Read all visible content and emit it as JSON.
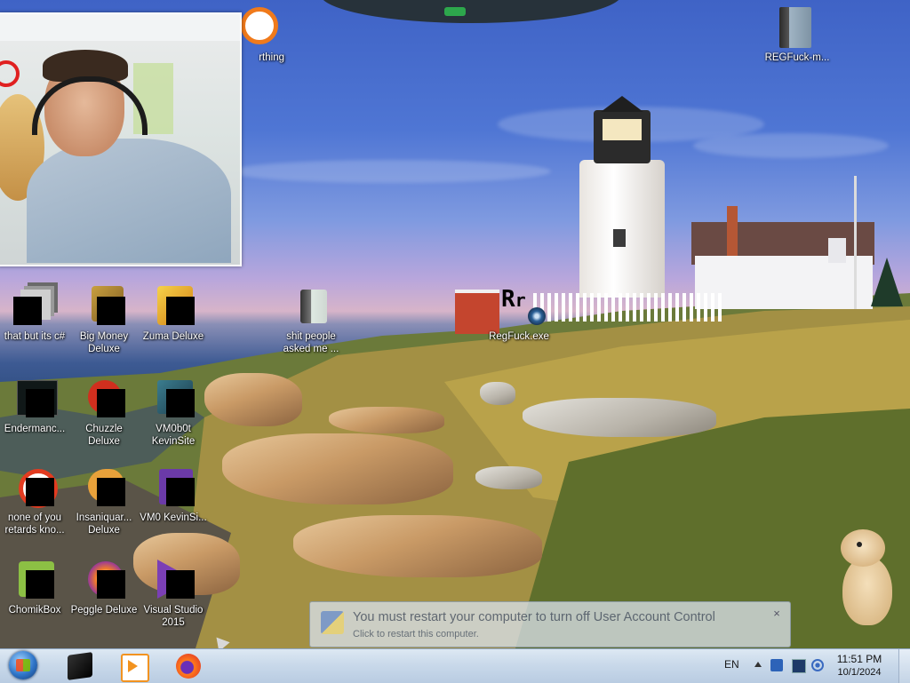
{
  "desktop": {
    "icons": [
      {
        "label": "that but its c#",
        "icon": "folder-stack-icon"
      },
      {
        "label": "Big Money Deluxe",
        "icon": "money-bag-icon"
      },
      {
        "label": "Zuma Deluxe",
        "icon": "zuma-icon"
      },
      {
        "label": "shit people asked me ...",
        "icon": "folder-icon"
      },
      {
        "label": "RegFuck.exe",
        "icon": "regfuck-exe-icon"
      },
      {
        "label": "REGFuck-m...",
        "icon": "folder-icon"
      },
      {
        "label": "Endermanc...",
        "icon": "enderman-icon"
      },
      {
        "label": "Chuzzle Deluxe",
        "icon": "chuzzle-icon"
      },
      {
        "label": "VM0b0t KevinSite",
        "icon": "vmobot-icon"
      },
      {
        "label": "none of you retards kno...",
        "icon": "orange-app-icon"
      },
      {
        "label": "Insaniquar... Deluxe",
        "icon": "insaniquarium-icon"
      },
      {
        "label": "VM0 KevinSi...",
        "icon": "vm0-icon"
      },
      {
        "label": "ChomikBox",
        "icon": "chomikbox-icon"
      },
      {
        "label": "Peggle Deluxe",
        "icon": "peggle-icon"
      },
      {
        "label": "Visual Studio 2015",
        "icon": "visual-studio-icon"
      },
      {
        "label": "rthing",
        "icon": "orange-ring-icon"
      }
    ]
  },
  "uac_notification": {
    "title": "You must restart your computer to turn off User Account Control",
    "subtitle": "Click to restart this computer."
  },
  "taskbar": {
    "pinned": [
      {
        "name": "internet-explorer-icon"
      },
      {
        "name": "windows-media-player-icon"
      },
      {
        "name": "firefox-icon"
      }
    ],
    "tray": {
      "language": "EN",
      "time": "11:51 PM",
      "date": "10/1/2024"
    }
  },
  "colors": {
    "taskbar": "#c9d9ea",
    "accent_orange": "#f07a1b"
  }
}
